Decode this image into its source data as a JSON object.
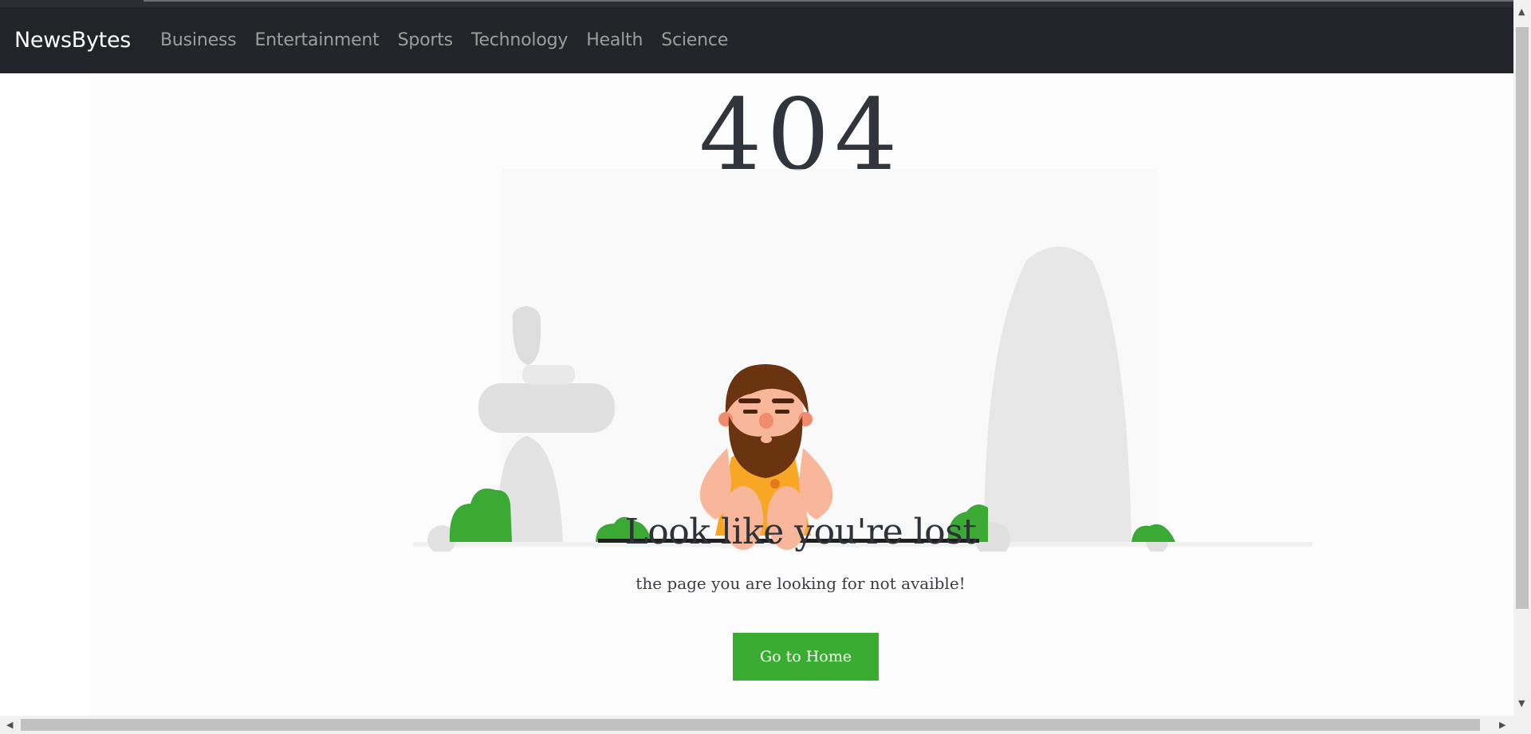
{
  "navbar": {
    "brand": "NewsBytes",
    "links": [
      {
        "label": "Business"
      },
      {
        "label": "Entertainment"
      },
      {
        "label": "Sports"
      },
      {
        "label": "Technology"
      },
      {
        "label": "Health"
      },
      {
        "label": "Science"
      }
    ]
  },
  "error_page": {
    "code": "404",
    "headline": "Look like you're lost",
    "message": "the page you are looking for not avaible!",
    "home_button": "Go to Home"
  },
  "colors": {
    "navbar_bg": "#212529",
    "button_green": "#39ac31",
    "bush_green": "#3aaa35",
    "rock_gray": "#e6e6e6"
  },
  "icons": {
    "scroll_up": "arrow-up-icon",
    "scroll_down": "arrow-down-icon",
    "scroll_left": "arrow-left-icon",
    "scroll_right": "arrow-right-icon"
  }
}
